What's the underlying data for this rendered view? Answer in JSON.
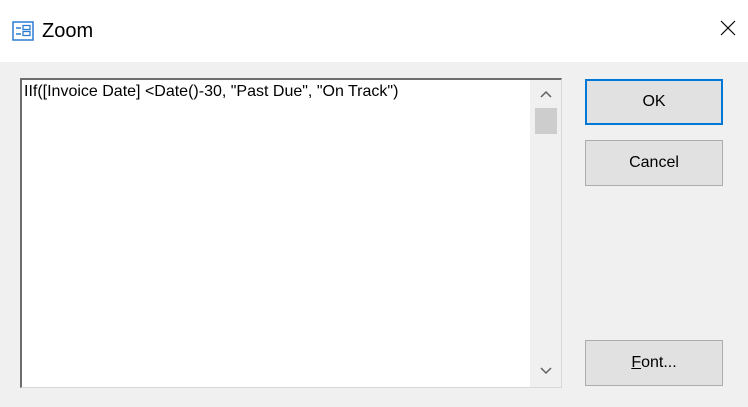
{
  "window": {
    "title": "Zoom",
    "icon": "form-icon"
  },
  "editor": {
    "value": "IIf([Invoice Date] <Date()-30, \"Past Due\", \"On Track\")"
  },
  "buttons": {
    "ok_label": "OK",
    "cancel_label": "Cancel",
    "font_label_mnemonic": "F",
    "font_label_rest": "ont..."
  },
  "colors": {
    "default_button_border": "#0078d7",
    "button_face": "#e1e1e1",
    "dialog_background": "#f0f0f0"
  }
}
